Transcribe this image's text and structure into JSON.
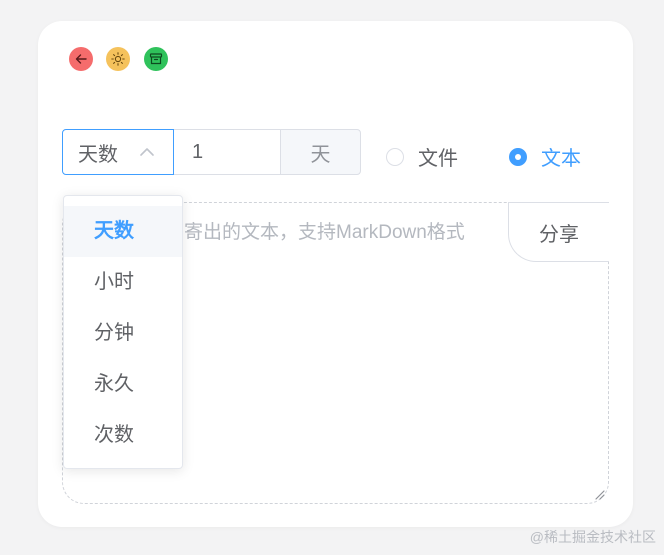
{
  "window": {
    "buttons": [
      {
        "name": "back",
        "color": "#f56c6c"
      },
      {
        "name": "theme",
        "color": "#f5c25c"
      },
      {
        "name": "archive",
        "color": "#2fc25b"
      }
    ]
  },
  "expiry": {
    "select_value": "天数",
    "amount_value": "1",
    "unit_label": "天"
  },
  "mode": {
    "options": [
      {
        "label": "文件",
        "selected": false
      },
      {
        "label": "文本",
        "selected": true
      }
    ]
  },
  "editor": {
    "placeholder": "寄出的文本，支持MarkDown格式",
    "share_label": "分享"
  },
  "dropdown": {
    "items": [
      {
        "label": "天数",
        "active": true
      },
      {
        "label": "小时",
        "active": false
      },
      {
        "label": "分钟",
        "active": false
      },
      {
        "label": "永久",
        "active": false
      },
      {
        "label": "次数",
        "active": false
      }
    ]
  },
  "watermark": "@稀土掘金技术社区",
  "colors": {
    "accent": "#409eff",
    "card": "#ffffff",
    "background": "#f3f3f4"
  }
}
